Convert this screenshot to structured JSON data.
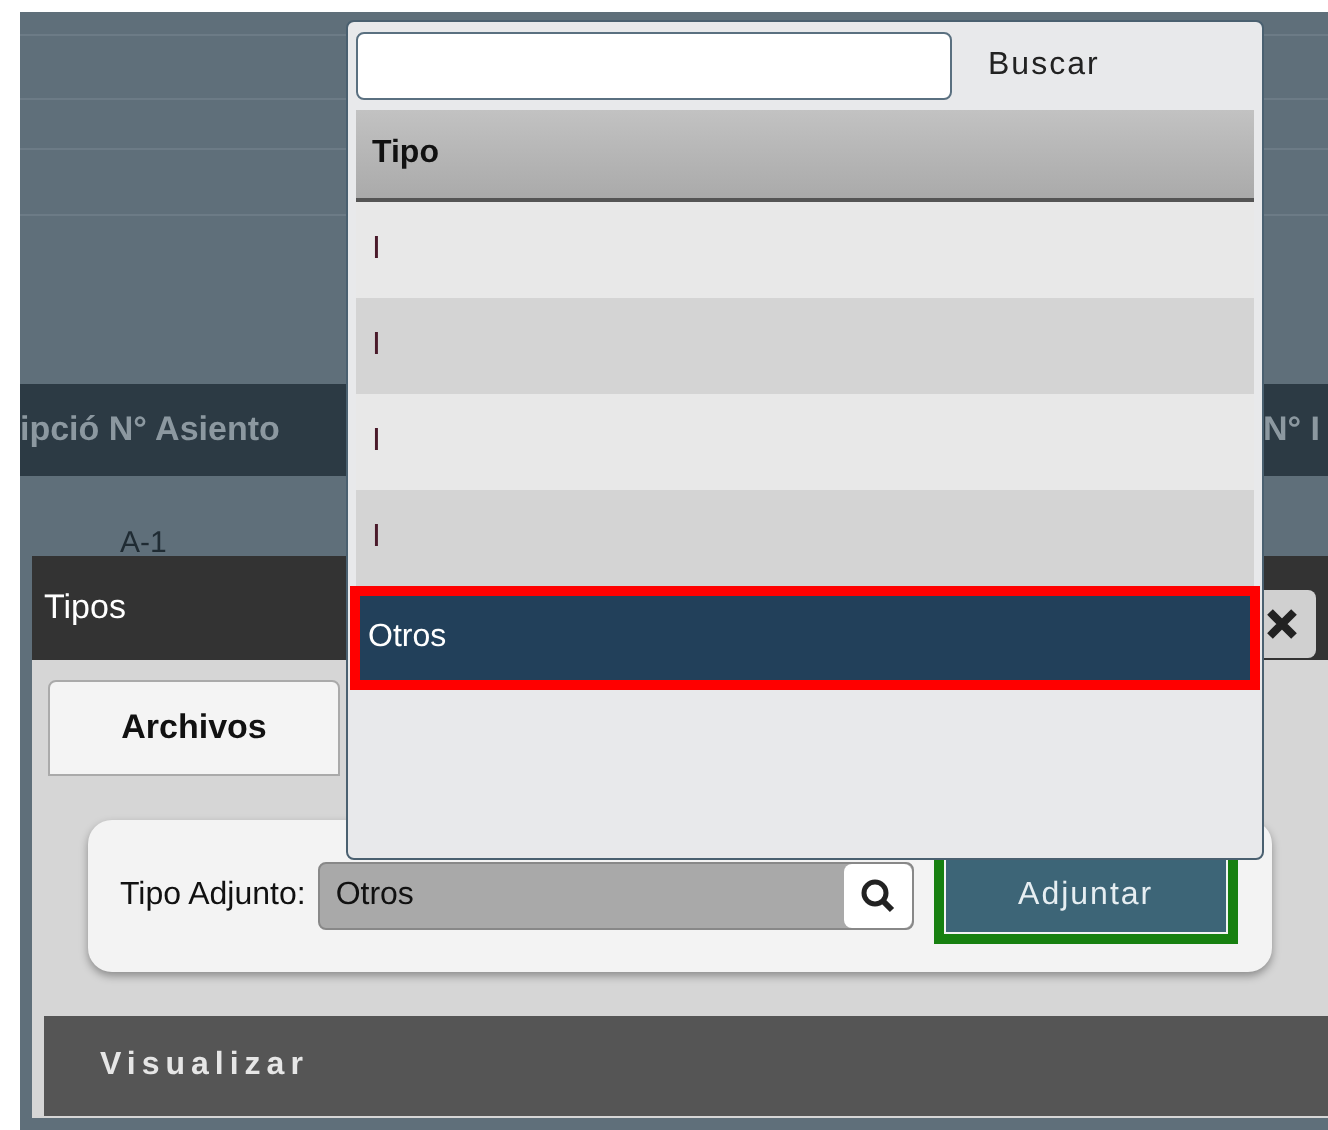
{
  "background_table": {
    "columns": [
      "ipció N° Asiento",
      "N° I"
    ],
    "rows": [
      [
        "A-1"
      ]
    ]
  },
  "dialog": {
    "title": "Tipos",
    "tabs": [
      {
        "label": "Archivos",
        "selected": true
      }
    ],
    "field": {
      "label": "Tipo Adjunto:",
      "value": "Otros"
    },
    "button": "Adjuntar",
    "section": "Visualizar"
  },
  "popup": {
    "search": {
      "button": "Buscar"
    },
    "column": "Tipo",
    "rows": [
      {
        "label": "I",
        "selected": false
      },
      {
        "label": "I",
        "selected": false
      },
      {
        "label": "I",
        "selected": false
      },
      {
        "label": "I",
        "selected": false
      },
      {
        "label": "Otros",
        "selected": true
      }
    ]
  }
}
